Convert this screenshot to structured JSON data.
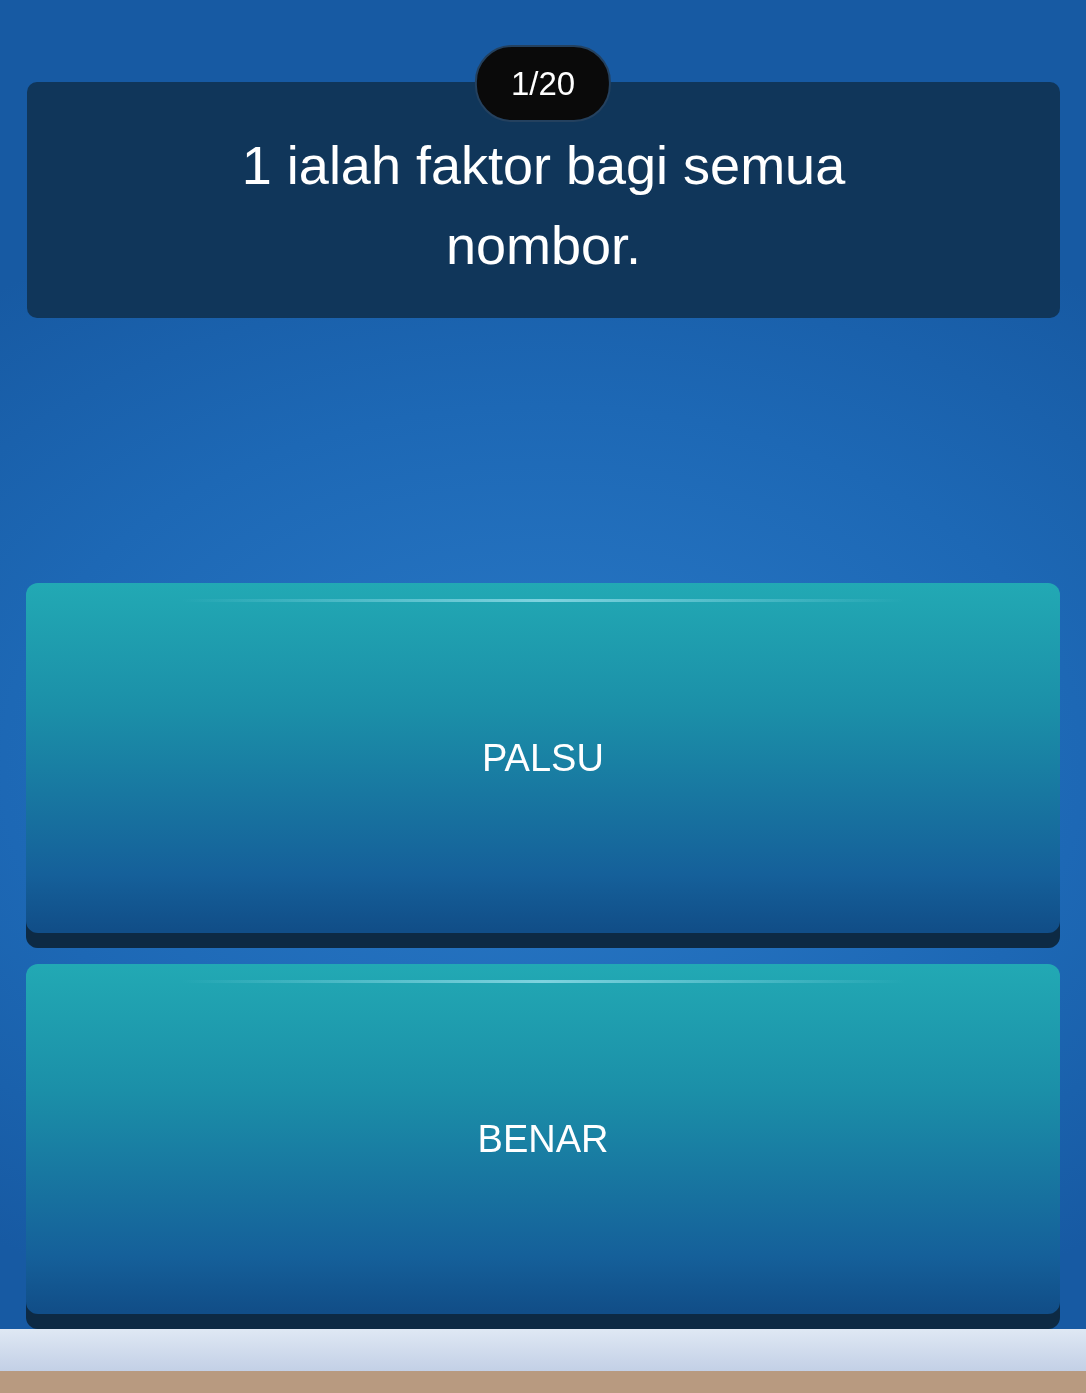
{
  "counter": "1/20",
  "question": "1 ialah faktor bagi semua nombor.",
  "answers": [
    {
      "label": "PALSU"
    },
    {
      "label": "BENAR"
    }
  ]
}
